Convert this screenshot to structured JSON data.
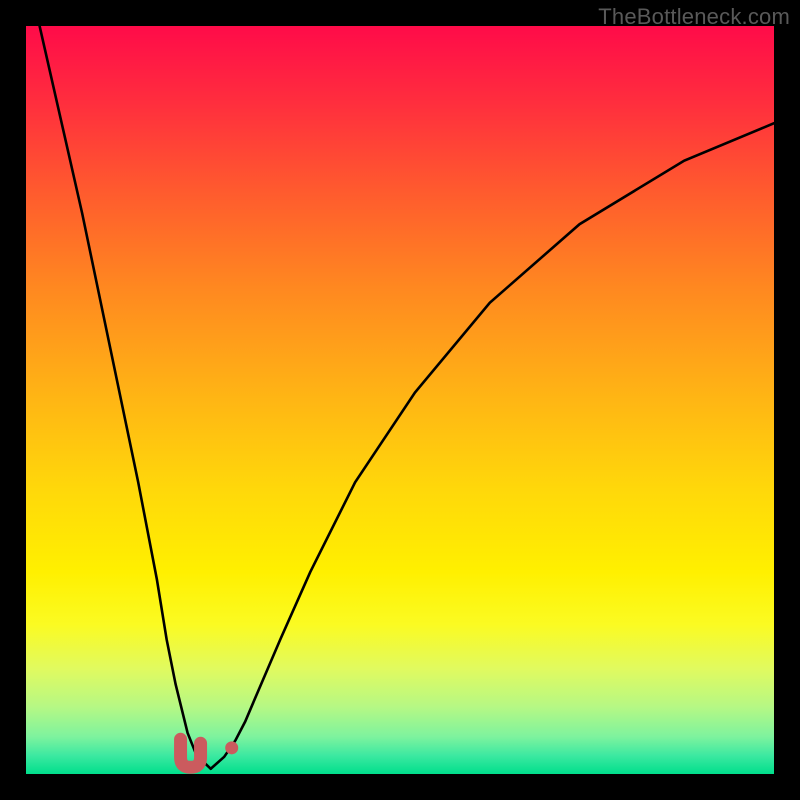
{
  "watermark": "TheBottleneck.com",
  "gradient": {
    "stops": [
      {
        "offset": 0.0,
        "color": "#ff0b49"
      },
      {
        "offset": 0.1,
        "color": "#ff2d3e"
      },
      {
        "offset": 0.22,
        "color": "#ff5a2e"
      },
      {
        "offset": 0.35,
        "color": "#ff8820"
      },
      {
        "offset": 0.5,
        "color": "#ffb614"
      },
      {
        "offset": 0.62,
        "color": "#ffd80a"
      },
      {
        "offset": 0.73,
        "color": "#fff000"
      },
      {
        "offset": 0.8,
        "color": "#fbfb22"
      },
      {
        "offset": 0.86,
        "color": "#e0fa60"
      },
      {
        "offset": 0.91,
        "color": "#b6f884"
      },
      {
        "offset": 0.95,
        "color": "#7ef39e"
      },
      {
        "offset": 0.975,
        "color": "#3de9a1"
      },
      {
        "offset": 1.0,
        "color": "#00df8c"
      }
    ]
  },
  "chart_data": {
    "type": "line",
    "title": "",
    "xlabel": "",
    "ylabel": "",
    "xlim": [
      0,
      100
    ],
    "ylim": [
      0,
      100
    ],
    "series": [
      {
        "name": "left-curve",
        "x": [
          0.0,
          2.5,
          5.0,
          7.5,
          10.0,
          12.5,
          15.0,
          17.5,
          18.8,
          20.0,
          21.6,
          22.8,
          24.7
        ],
        "values": [
          108,
          97,
          86,
          75,
          63,
          51,
          39,
          26,
          18,
          12,
          5.5,
          2.5,
          0.7
        ]
      },
      {
        "name": "right-curve",
        "x": [
          24.7,
          26.5,
          28.0,
          29.3,
          31.0,
          34.0,
          38.0,
          44.0,
          52.0,
          62.0,
          74.0,
          88.0,
          100.0
        ],
        "values": [
          0.7,
          2.3,
          4.5,
          7.0,
          11.0,
          18.0,
          27.0,
          39.0,
          51.0,
          63.0,
          73.5,
          82.0,
          87.0
        ]
      }
    ],
    "markers": [
      {
        "name": "u-marker",
        "shape": "U",
        "x": 22.0,
        "y": 2.5,
        "color": "#cb5b5e",
        "size": 8
      },
      {
        "name": "dot-marker",
        "shape": "dot",
        "x": 27.5,
        "y": 3.5,
        "color": "#cb5b5e",
        "size": 5
      }
    ],
    "minimum_x": 24.7
  }
}
